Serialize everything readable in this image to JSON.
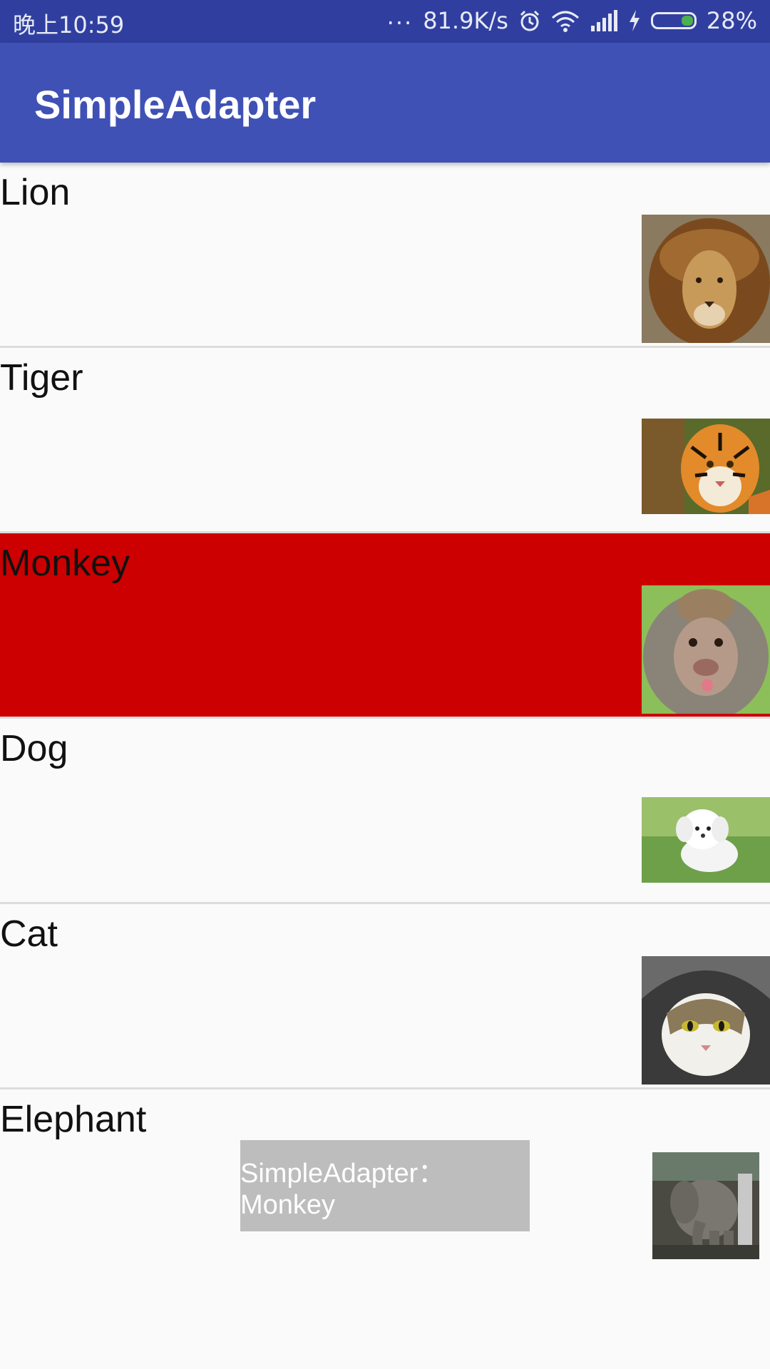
{
  "status_bar": {
    "time": "晚上10:59",
    "more": "...",
    "speed": "81.9K/s",
    "battery": "28%",
    "icons": [
      "alarm-icon",
      "wifi-icon",
      "signal-icon",
      "charging-icon",
      "battery-icon"
    ]
  },
  "app_bar": {
    "title": "SimpleAdapter"
  },
  "list": {
    "items": [
      {
        "label": "Lion",
        "image": "lion-photo"
      },
      {
        "label": "Tiger",
        "image": "tiger-photo"
      },
      {
        "label": "Monkey",
        "image": "monkey-photo",
        "selected": true
      },
      {
        "label": "Dog",
        "image": "dog-photo"
      },
      {
        "label": "Cat",
        "image": "cat-photo"
      },
      {
        "label": "Elephant",
        "image": "elephant-photo"
      }
    ]
  },
  "toast": {
    "text": "SimpleAdapter：Monkey"
  },
  "colors": {
    "status_bar": "#303f9f",
    "app_bar": "#3f51b5",
    "selected_row": "#cc0000",
    "background": "#fafafa",
    "toast": "#bdbdbd"
  }
}
